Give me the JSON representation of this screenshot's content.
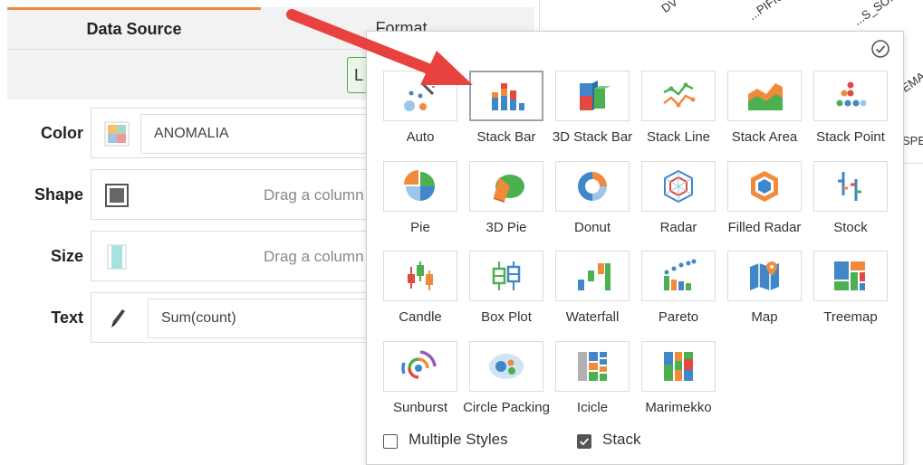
{
  "tabs": {
    "data_source": "Data Source",
    "format": "Format"
  },
  "subbar": {
    "button_glyph": "L"
  },
  "rows": [
    {
      "label": "Color",
      "value": "ANOMALIA"
    },
    {
      "label": "Shape",
      "value": "Drag a column"
    },
    {
      "label": "Size",
      "value": "Drag a column"
    },
    {
      "label": "Text",
      "value": "Sum(count)"
    }
  ],
  "background_headers": [
    "DV",
    "...PIFIU...",
    "...S_SO...",
    "...EMA",
    "SPE"
  ],
  "chart_types": [
    {
      "label": "Auto",
      "icon": "auto-icon"
    },
    {
      "label": "Stack Bar",
      "icon": "stack-bar-icon"
    },
    {
      "label": "3D Stack Bar",
      "icon": "3d-stack-bar-icon"
    },
    {
      "label": "Stack Line",
      "icon": "stack-line-icon"
    },
    {
      "label": "Stack Area",
      "icon": "stack-area-icon"
    },
    {
      "label": "Stack Point",
      "icon": "stack-point-icon"
    },
    {
      "label": "Pie",
      "icon": "pie-icon"
    },
    {
      "label": "3D Pie",
      "icon": "3d-pie-icon"
    },
    {
      "label": "Donut",
      "icon": "donut-icon"
    },
    {
      "label": "Radar",
      "icon": "radar-icon"
    },
    {
      "label": "Filled Radar",
      "icon": "filled-radar-icon"
    },
    {
      "label": "Stock",
      "icon": "stock-icon"
    },
    {
      "label": "Candle",
      "icon": "candle-icon"
    },
    {
      "label": "Box Plot",
      "icon": "box-plot-icon"
    },
    {
      "label": "Waterfall",
      "icon": "waterfall-icon"
    },
    {
      "label": "Pareto",
      "icon": "pareto-icon"
    },
    {
      "label": "Map",
      "icon": "map-icon"
    },
    {
      "label": "Treemap",
      "icon": "treemap-icon"
    },
    {
      "label": "Sunburst",
      "icon": "sunburst-icon"
    },
    {
      "label": "Circle Packing",
      "icon": "circle-packing-icon"
    },
    {
      "label": "Icicle",
      "icon": "icicle-icon"
    },
    {
      "label": "Marimekko",
      "icon": "marimekko-icon"
    }
  ],
  "selected_chart": "Stack Bar",
  "options": {
    "multiple_styles": {
      "label": "Multiple Styles",
      "checked": false
    },
    "stack": {
      "label": "Stack",
      "checked": true
    }
  },
  "colors": {
    "accent": "#f28a3c",
    "arrow": "#e8423f",
    "blue": "#3f87c9",
    "green": "#4caf50",
    "orange": "#f28a3c",
    "red": "#e04a3f"
  }
}
